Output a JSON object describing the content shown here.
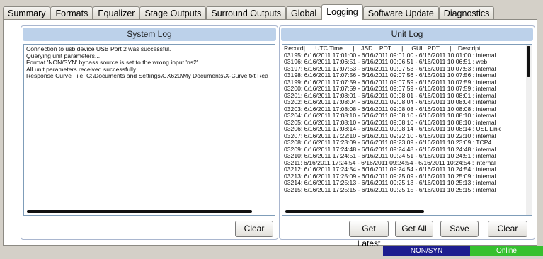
{
  "tabs": [
    {
      "label": "Summary"
    },
    {
      "label": "Formats"
    },
    {
      "label": "Equalizer"
    },
    {
      "label": "Stage Outputs"
    },
    {
      "label": "Surround Outputs"
    },
    {
      "label": "Global"
    },
    {
      "label": "Logging",
      "active": true
    },
    {
      "label": "Software Update"
    },
    {
      "label": "Diagnostics"
    }
  ],
  "system_log": {
    "title": "System Log",
    "lines": [
      "Connection to usb device USB Port 2 was successful.",
      "Querying unit parameters...",
      "Format 'NON/SYN' bypass source is set to the wrong input 'ns2'",
      "All unit parameters received successfully.",
      "Response Curve File: C:\\Documents and Settings\\GX620\\My Documents\\X-Curve.txt Rea"
    ],
    "clear_label": "Clear"
  },
  "unit_log": {
    "title": "Unit Log",
    "header": "Record|      UTC Time      |    JSD    PDT      |     GUI   PDT      |    Descript",
    "lines": [
      "03195: 6/16/2011 17:01:00 - 6/16/2011 09:01:00 - 6/16/2011 10:01:00 : internal",
      "03196: 6/16/2011 17:06:51 - 6/16/2011 09:06:51 - 6/16/2011 10:06:51 : web",
      "03197: 6/16/2011 17:07:53 - 6/16/2011 09:07:53 - 6/16/2011 10:07:53 : internal",
      "03198: 6/16/2011 17:07:56 - 6/16/2011 09:07:56 - 6/16/2011 10:07:56 : internal",
      "03199: 6/16/2011 17:07:59 - 6/16/2011 09:07:59 - 6/16/2011 10:07:59 : internal",
      "03200: 6/16/2011 17:07:59 - 6/16/2011 09:07:59 - 6/16/2011 10:07:59 : internal",
      "03201: 6/16/2011 17:08:01 - 6/16/2011 09:08:01 - 6/16/2011 10:08:01 : internal",
      "03202: 6/16/2011 17:08:04 - 6/16/2011 09:08:04 - 6/16/2011 10:08:04 : internal",
      "03203: 6/16/2011 17:08:08 - 6/16/2011 09:08:08 - 6/16/2011 10:08:08 : internal",
      "03204: 6/16/2011 17:08:10 - 6/16/2011 09:08:10 - 6/16/2011 10:08:10 : internal",
      "03205: 6/16/2011 17:08:10 - 6/16/2011 09:08:10 - 6/16/2011 10:08:10 : internal",
      "03206: 6/16/2011 17:08:14 - 6/16/2011 09:08:14 - 6/16/2011 10:08:14 : USL Link",
      "03207: 6/16/2011 17:22:10 - 6/16/2011 09:22:10 - 6/16/2011 10:22:10 : internal",
      "03208: 6/16/2011 17:23:09 - 6/16/2011 09:23:09 - 6/16/2011 10:23:09 : TCP4",
      "03209: 6/16/2011 17:24:48 - 6/16/2011 09:24:48 - 6/16/2011 10:24:48 : internal",
      "03210: 6/16/2011 17:24:51 - 6/16/2011 09:24:51 - 6/16/2011 10:24:51 : internal",
      "03211: 6/16/2011 17:24:54 - 6/16/2011 09:24:54 - 6/16/2011 10:24:54 : internal",
      "03212: 6/16/2011 17:24:54 - 6/16/2011 09:24:54 - 6/16/2011 10:24:54 : internal",
      "03213: 6/16/2011 17:25:09 - 6/16/2011 09:25:09 - 6/16/2011 10:25:09 : internal",
      "03214: 6/16/2011 17:25:13 - 6/16/2011 09:25:13 - 6/16/2011 10:25:13 : internal",
      "03215: 6/16/2011 17:25:15 - 6/16/2011 09:25:15 - 6/16/2011 10:25:15 : internal"
    ],
    "buttons": {
      "get_latest": "Get Latest",
      "get_all": "Get All",
      "save": "Save",
      "clear": "Clear"
    }
  },
  "status": {
    "mode": "NON/SYN",
    "connection": "Online",
    "mode_color": "#1d1d8f",
    "connection_color": "#35c12e"
  }
}
